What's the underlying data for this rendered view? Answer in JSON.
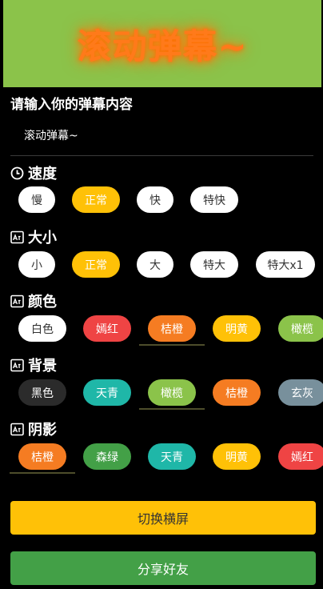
{
  "preview": {
    "text": "滚动弹幕~",
    "background": "#8bc34a",
    "text_color": "#ff7a1a"
  },
  "prompt": "请输入你的弹幕内容",
  "input": {
    "value": "滚动弹幕~"
  },
  "speed": {
    "title": "速度",
    "icon": "clock-icon",
    "options": [
      "慢",
      "正常",
      "快",
      "特快"
    ],
    "selected": "正常"
  },
  "size": {
    "title": "大小",
    "icon": "text-size-icon",
    "options": [
      "小",
      "正常",
      "大",
      "特大",
      "特大x1"
    ],
    "selected": "正常"
  },
  "color": {
    "title": "颜色",
    "icon": "text-size-icon",
    "options": [
      "白色",
      "嫣红",
      "桔橙",
      "明黄",
      "橄榄"
    ],
    "selected": "桔橙"
  },
  "background": {
    "title": "背景",
    "icon": "text-size-icon",
    "options": [
      "黑色",
      "天青",
      "橄榄",
      "桔橙",
      "玄灰"
    ],
    "selected": "橄榄"
  },
  "shadow": {
    "title": "阴影",
    "icon": "text-size-icon",
    "options": [
      "桔橙",
      "森绿",
      "天青",
      "明黄",
      "嫣红"
    ],
    "selected": "桔橙"
  },
  "buttons": {
    "orientation": "切换横屏",
    "share": "分享好友"
  },
  "colors": {
    "accent": "#ffc107",
    "green": "#43a047",
    "orange": "#f57c22",
    "red": "#ef4444",
    "teal": "#1fb7a8",
    "olive": "#8bc34a",
    "gray": "#78909c"
  }
}
